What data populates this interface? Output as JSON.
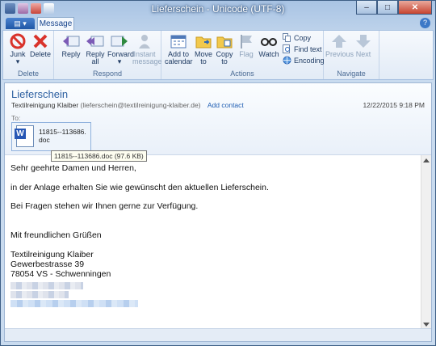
{
  "window": {
    "title": "Lieferschein - Unicode (UTF-8)",
    "minimize": "–",
    "maximize": "□",
    "close": "✕"
  },
  "colors": {
    "accent": "#2c5fa0",
    "delete_red": "#d9332b",
    "titlebar": "#a9c4e4"
  },
  "app_menu": {
    "label": "▤ ▾"
  },
  "tabs": [
    {
      "label": "Message"
    }
  ],
  "help": {
    "label": "?"
  },
  "ribbon": {
    "groups": [
      {
        "label": "Delete",
        "buttons": [
          {
            "label": "Junk",
            "icon": "junk-icon"
          },
          {
            "label": "Delete",
            "icon": "delete-x-icon"
          }
        ]
      },
      {
        "label": "Respond",
        "buttons": [
          {
            "label": "Reply",
            "icon": "reply-icon"
          },
          {
            "label": "Reply all",
            "icon": "reply-all-icon"
          },
          {
            "label": "Forward",
            "icon": "forward-icon"
          },
          {
            "label": "Instant message",
            "icon": "instant-message-icon"
          }
        ]
      },
      {
        "label": "Actions",
        "buttons": [
          {
            "label": "Add to calendar",
            "icon": "calendar-icon"
          },
          {
            "label": "Move to",
            "icon": "move-folder-icon"
          },
          {
            "label": "Copy to",
            "icon": "copy-folder-icon"
          },
          {
            "label": "Flag",
            "icon": "flag-icon"
          },
          {
            "label": "Watch",
            "icon": "glasses-icon"
          }
        ],
        "small": [
          {
            "label": "Copy",
            "icon": "copy-icon"
          },
          {
            "label": "Find text",
            "icon": "find-icon"
          },
          {
            "label": "Encoding",
            "icon": "encoding-icon"
          }
        ]
      },
      {
        "label": "Navigate",
        "buttons": [
          {
            "label": "Previous",
            "icon": "arrow-up-icon"
          },
          {
            "label": "Next",
            "icon": "arrow-down-icon"
          }
        ]
      }
    ]
  },
  "message": {
    "subject": "Lieferschein",
    "from_name": "Textilreinigung Klaiber",
    "from_addr": "(lieferschein@textilreinigung-klaiber.de)",
    "add_contact": "Add contact",
    "date": "12/22/2015 9:18 PM",
    "to_label": "To:",
    "attachment": {
      "name_line1": "11815--113686.",
      "name_line2": "doc",
      "tooltip": "11815--113686.doc (97.6 KB)"
    },
    "body": [
      "Sehr geehrte Damen und Herren,",
      "in der Anlage erhalten Sie wie gewünscht den aktuellen Lieferschein.",
      "Bei Fragen stehen wir Ihnen gerne zur Verfügung.",
      "Mit freundlichen Grüßen",
      "Textilreinigung Klaiber",
      "Gewerbestrasse 39",
      "78054 VS - Schwenningen"
    ]
  }
}
